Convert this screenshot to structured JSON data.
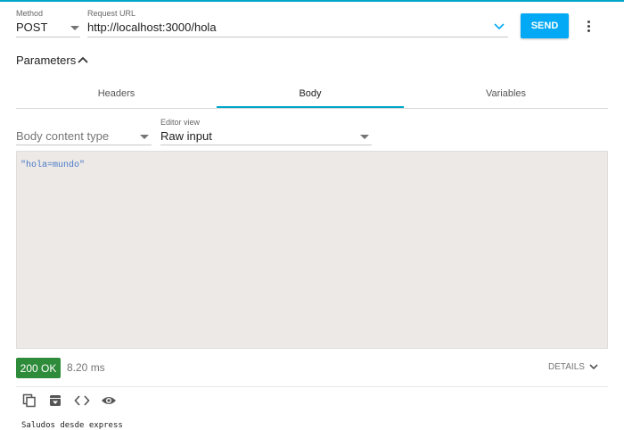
{
  "request": {
    "method_label": "Method",
    "method_value": "POST",
    "url_label": "Request URL",
    "url_value": "http://localhost:3000/hola",
    "send_label": "SEND"
  },
  "parameters": {
    "title": "Parameters",
    "expanded": true
  },
  "tabs": [
    {
      "label": "Headers",
      "active": false
    },
    {
      "label": "Body",
      "active": true
    },
    {
      "label": "Variables",
      "active": false
    }
  ],
  "body": {
    "content_type_placeholder": "Body content type",
    "editor_view_label": "Editor view",
    "editor_view_value": "Raw input",
    "content": "\"hola=mundo\""
  },
  "response": {
    "status": "200 OK",
    "time": "8.20 ms",
    "details_label": "DETAILS",
    "status_color": "#2e8b3a",
    "text": "Saludos desde express"
  },
  "response_actions": [
    {
      "icon": "copy-icon"
    },
    {
      "icon": "archive-icon"
    },
    {
      "icon": "code-icon"
    },
    {
      "icon": "eye-icon"
    }
  ],
  "colors": {
    "accent": "#00a6c8",
    "send_button": "#03a9f4",
    "editor_background": "#ece9e6"
  }
}
